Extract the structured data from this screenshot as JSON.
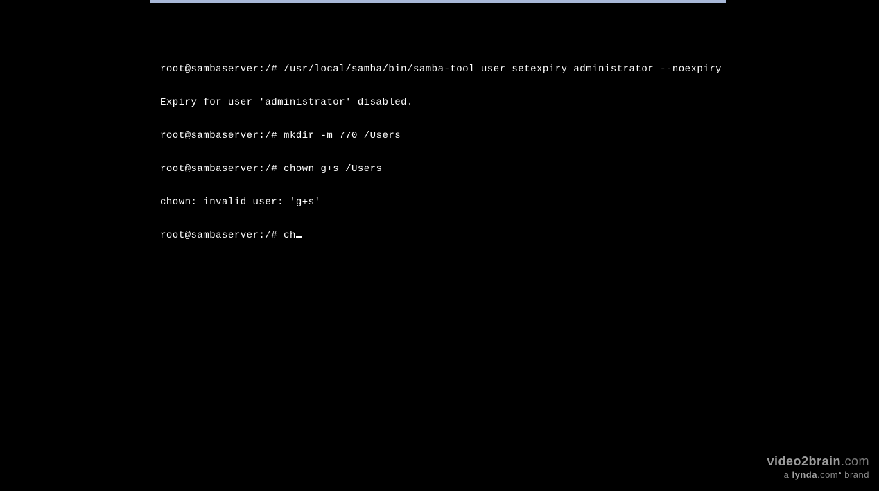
{
  "terminal": {
    "lines": [
      {
        "prompt": "root@sambaserver:/#",
        "cmd": " /usr/local/samba/bin/samba-tool user setexpiry administrator --noexpiry"
      },
      {
        "output": "Expiry for user 'administrator' disabled."
      },
      {
        "prompt": "root@sambaserver:/#",
        "cmd": " mkdir -m 770 /Users"
      },
      {
        "prompt": "root@sambaserver:/#",
        "cmd": " chown g+s /Users"
      },
      {
        "output": "chown: invalid user: 'g+s'"
      },
      {
        "prompt": "root@sambaserver:/#",
        "cmd": " ch",
        "cursor": true
      }
    ]
  },
  "watermark": {
    "brand": "video2brain",
    "tld": ".com",
    "sub_a": "a ",
    "sub_lynda": "lynda",
    "sub_com": ".com",
    "sub_brand": " brand"
  }
}
